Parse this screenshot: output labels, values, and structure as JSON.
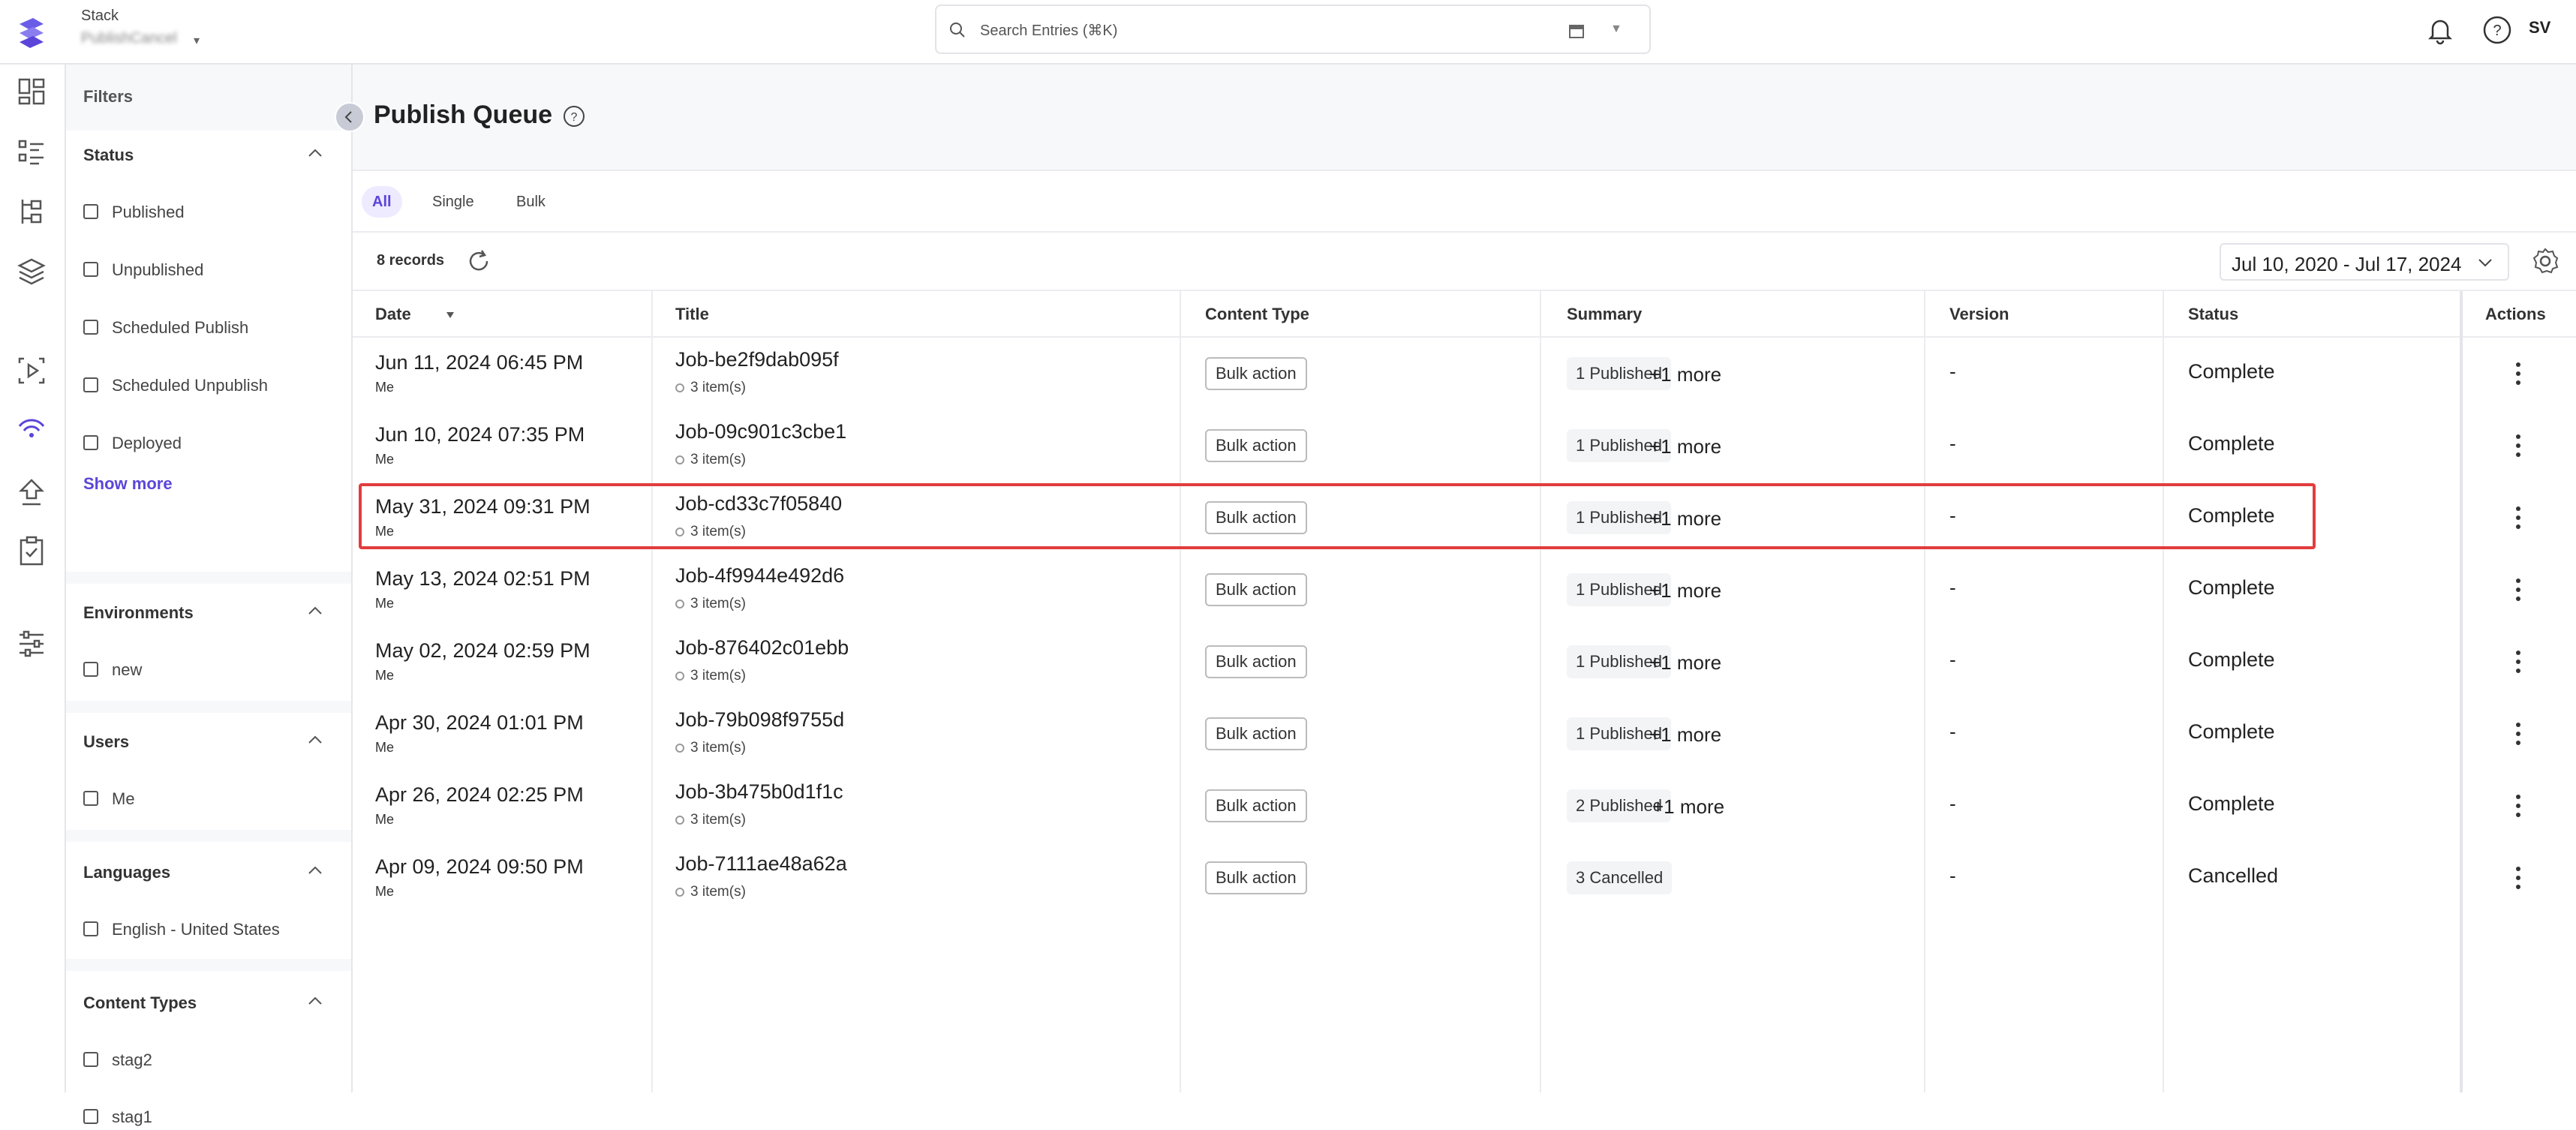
{
  "header": {
    "stack_label": "Stack",
    "stack_name": "PublishCancel",
    "search_placeholder": "Search Entries (⌘K)",
    "user_initials": "SV"
  },
  "rail_icons": [
    "dashboard-icon",
    "entries-icon",
    "content-models-icon",
    "assets-icon",
    "releases-icon",
    "publish-queue-icon",
    "deploy-icon",
    "tasks-icon",
    "settings-icon"
  ],
  "filters": {
    "title": "Filters",
    "status": {
      "title": "Status",
      "options": [
        "Published",
        "Unpublished",
        "Scheduled Publish",
        "Scheduled Unpublish",
        "Deployed"
      ],
      "show_more": "Show more"
    },
    "environments": {
      "title": "Environments",
      "options": [
        "new"
      ]
    },
    "users": {
      "title": "Users",
      "options": [
        "Me"
      ]
    },
    "languages": {
      "title": "Languages",
      "options": [
        "English - United States"
      ]
    },
    "content_types": {
      "title": "Content Types",
      "options": [
        "stag2",
        "stag1"
      ]
    }
  },
  "page": {
    "title": "Publish Queue",
    "tabs": [
      {
        "label": "All",
        "active": true
      },
      {
        "label": "Single",
        "active": false
      },
      {
        "label": "Bulk",
        "active": false
      }
    ],
    "records": "8 records",
    "date_range": "Jul 10, 2020 - Jul 17, 2024"
  },
  "table": {
    "columns": [
      "Date",
      "Title",
      "Content Type",
      "Summary",
      "Version",
      "Status",
      "Actions"
    ],
    "rows": [
      {
        "date": "Jun 11, 2024 06:45 PM",
        "user": "Me",
        "title": "Job-be2f9dab095f",
        "items": "3 item(s)",
        "content_type": "Bulk action",
        "summary": "1 Published",
        "more": "+1 more",
        "version": "-",
        "status": "Complete",
        "highlighted": false
      },
      {
        "date": "Jun 10, 2024 07:35 PM",
        "user": "Me",
        "title": "Job-09c901c3cbe1",
        "items": "3 item(s)",
        "content_type": "Bulk action",
        "summary": "1 Published",
        "more": "+1 more",
        "version": "-",
        "status": "Complete",
        "highlighted": false
      },
      {
        "date": "May 31, 2024 09:31 PM",
        "user": "Me",
        "title": "Job-cd33c7f05840",
        "items": "3 item(s)",
        "content_type": "Bulk action",
        "summary": "1 Published",
        "more": "+1 more",
        "version": "-",
        "status": "Complete",
        "highlighted": true
      },
      {
        "date": "May 13, 2024 02:51 PM",
        "user": "Me",
        "title": "Job-4f9944e492d6",
        "items": "3 item(s)",
        "content_type": "Bulk action",
        "summary": "1 Published",
        "more": "+1 more",
        "version": "-",
        "status": "Complete",
        "highlighted": false
      },
      {
        "date": "May 02, 2024 02:59 PM",
        "user": "Me",
        "title": "Job-876402c01ebb",
        "items": "3 item(s)",
        "content_type": "Bulk action",
        "summary": "1 Published",
        "more": "+1 more",
        "version": "-",
        "status": "Complete",
        "highlighted": false
      },
      {
        "date": "Apr 30, 2024 01:01 PM",
        "user": "Me",
        "title": "Job-79b098f9755d",
        "items": "3 item(s)",
        "content_type": "Bulk action",
        "summary": "1 Published",
        "more": "+1 more",
        "version": "-",
        "status": "Complete",
        "highlighted": false
      },
      {
        "date": "Apr 26, 2024 02:25 PM",
        "user": "Me",
        "title": "Job-3b475b0d1f1c",
        "items": "3 item(s)",
        "content_type": "Bulk action",
        "summary": "2 Published",
        "more": "+1 more",
        "version": "-",
        "status": "Complete",
        "highlighted": false
      },
      {
        "date": "Apr 09, 2024 09:50 PM",
        "user": "Me",
        "title": "Job-7111ae48a62a",
        "items": "3 item(s)",
        "content_type": "Bulk action",
        "summary": "3 Cancelled",
        "more": "",
        "version": "-",
        "status": "Cancelled",
        "highlighted": false
      }
    ]
  }
}
